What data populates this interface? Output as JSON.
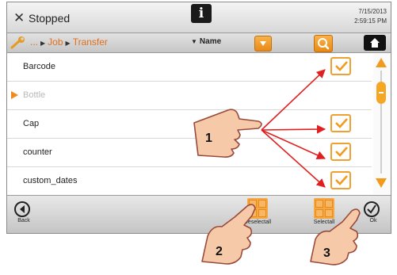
{
  "header": {
    "status": "Stopped",
    "info_icon": "info-icon",
    "date": "7/15/2013",
    "time": "2:59:15 PM"
  },
  "nav": {
    "breadcrumb": [
      "...",
      "Job",
      "Transfer"
    ],
    "sort_label": "Name"
  },
  "list": {
    "items": [
      {
        "label": "Barcode",
        "checked": true
      },
      {
        "label": "Bottle",
        "selected": true
      },
      {
        "label": "Cap",
        "checked": true
      },
      {
        "label": "counter",
        "checked": true
      },
      {
        "label": "custom_dates",
        "checked": true
      }
    ]
  },
  "bottom": {
    "back_label": "Back",
    "deselect_label": "Deselectall",
    "select_label": "Selectall",
    "ok_label": "Ok"
  },
  "callouts": [
    "1",
    "2",
    "3"
  ],
  "colors": {
    "accent": "#f29a1e",
    "arrow": "#e02020",
    "hand_fill": "#f6c9a8",
    "hand_stroke": "#9a4a3a"
  }
}
